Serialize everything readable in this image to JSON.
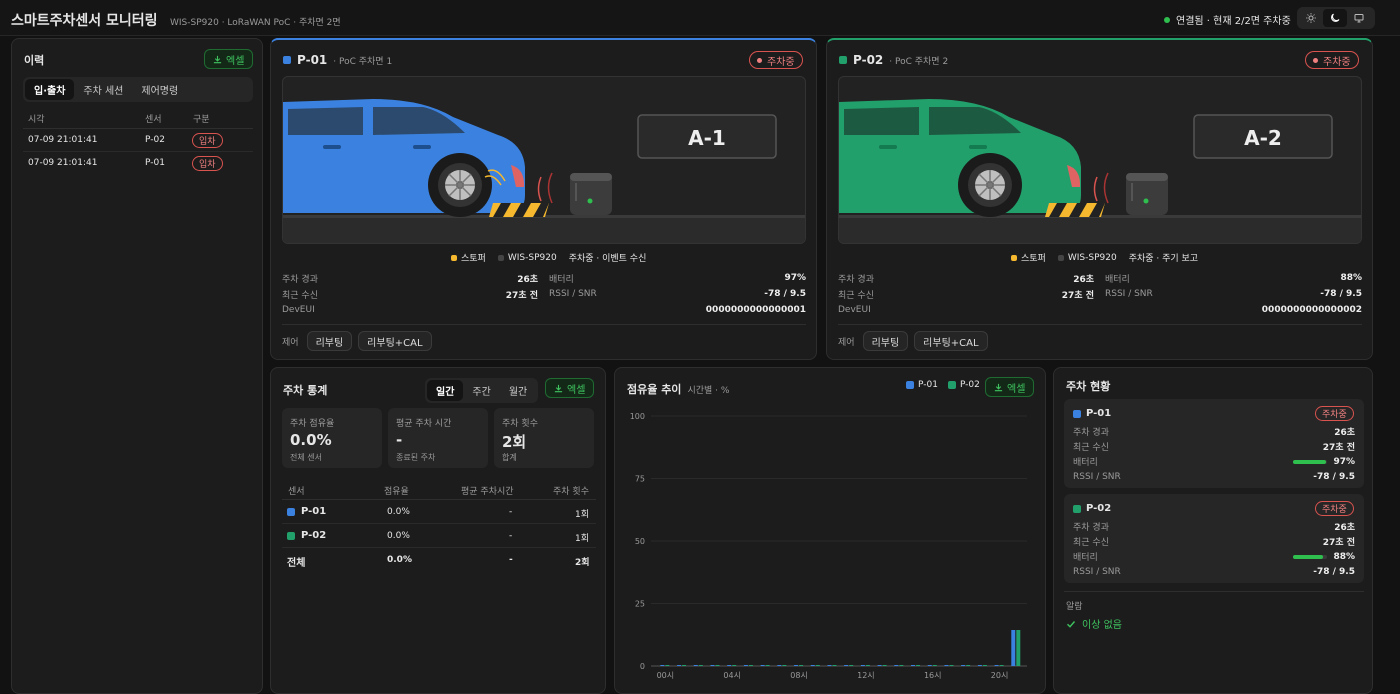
{
  "header": {
    "title": "스마트주차센서 모니터링",
    "subtitle": "WIS-SP920 · LoRaWAN PoC · 주차면 2면",
    "status": "연결됨 · 현재 2/2면 주차중",
    "theme_icons": [
      "sun-icon",
      "moon-icon",
      "monitor-icon"
    ],
    "status_color": "#2fbf4f"
  },
  "history": {
    "title": "이력",
    "export_label": "엑셀",
    "tabs": [
      "입·출차",
      "주차 세션",
      "제어명령"
    ],
    "columns": [
      "시각",
      "센서",
      "구분"
    ],
    "rows": [
      {
        "time": "07-09 21:01:41",
        "sensor": "P-02",
        "type": "입차"
      },
      {
        "time": "07-09 21:01:41",
        "sensor": "P-01",
        "type": "입차"
      }
    ]
  },
  "spots": [
    {
      "id": "P-01",
      "desc": "· PoC 주차면 1",
      "status": "주차중",
      "color": "#3b82e0",
      "sign": "A-1",
      "legend": [
        "스토퍼",
        "WIS-SP920",
        "주차중 · 이벤트 수신"
      ],
      "elapsed_label": "주차 경과",
      "elapsed": "26초",
      "battery_label": "배터리",
      "battery": "97%",
      "recv_label": "최근 수신",
      "recv": "27초 전",
      "rssi_label": "RSSI / SNR",
      "rssi": "-78 / 9.5",
      "deveui_label": "DevEUI",
      "deveui": "0000000000000001",
      "control_label": "제어",
      "btn_reboot": "리부팅",
      "btn_reboot_cal": "리부팅+CAL"
    },
    {
      "id": "P-02",
      "desc": "· PoC 주차면 2",
      "status": "주차중",
      "color": "#22a06b",
      "sign": "A-2",
      "legend": [
        "스토퍼",
        "WIS-SP920",
        "주차중 · 주기 보고"
      ],
      "elapsed_label": "주차 경과",
      "elapsed": "26초",
      "battery_label": "배터리",
      "battery": "88%",
      "recv_label": "최근 수신",
      "recv": "27초 전",
      "rssi_label": "RSSI / SNR",
      "rssi": "-78 / 9.5",
      "deveui_label": "DevEUI",
      "deveui": "0000000000000002",
      "control_label": "제어",
      "btn_reboot": "리부팅",
      "btn_reboot_cal": "리부팅+CAL"
    }
  ],
  "stats": {
    "title": "주차 통계",
    "periods": [
      "일간",
      "주간",
      "월간"
    ],
    "export_label": "엑셀",
    "boxes": [
      {
        "label": "주차 점유율",
        "value": "0.0%",
        "sub": "전체 센서"
      },
      {
        "label": "평균 주차 시간",
        "value": "-",
        "sub": "종료된 주차"
      },
      {
        "label": "주차 횟수",
        "value": "2회",
        "sub": "합계"
      }
    ],
    "columns": [
      "센서",
      "점유율",
      "평균 주차시간",
      "주차 횟수"
    ],
    "rows": [
      {
        "sensor": "P-01",
        "occ": "0.0%",
        "avg": "-",
        "count": "1회"
      },
      {
        "sensor": "P-02",
        "occ": "0.0%",
        "avg": "-",
        "count": "1회"
      }
    ],
    "total": {
      "sensor": "전체",
      "occ": "0.0%",
      "avg": "-",
      "count": "2회"
    }
  },
  "trend": {
    "title": "점유율 추이",
    "subtitle": "시간별 · %",
    "export_label": "엑셀"
  },
  "chart_data": {
    "type": "bar",
    "title": "점유율 추이",
    "subtitle": "시간별 · %",
    "ylim": [
      0,
      100
    ],
    "yticks": [
      "100",
      "75",
      "50",
      "25",
      "0"
    ],
    "xticks": [
      "00시",
      "04시",
      "08시",
      "12시",
      "16시",
      "20시"
    ],
    "grid": true,
    "legend": "top-right",
    "categories": [
      "0",
      "1",
      "2",
      "3",
      "4",
      "5",
      "6",
      "7",
      "8",
      "9",
      "10",
      "11",
      "12",
      "13",
      "14",
      "15",
      "16",
      "17",
      "18",
      "19",
      "20",
      "21"
    ],
    "series": [
      {
        "name": "P-01",
        "color": "#3b82e0",
        "values": [
          0,
          0,
          0,
          0,
          0,
          0,
          0,
          0,
          0,
          0,
          0,
          0,
          0,
          0,
          0,
          0,
          0,
          0,
          0,
          0,
          0,
          14
        ]
      },
      {
        "name": "P-02",
        "color": "#22a06b",
        "values": [
          0,
          0,
          0,
          0,
          0,
          0,
          0,
          0,
          0,
          0,
          0,
          0,
          0,
          0,
          0,
          0,
          0,
          0,
          0,
          0,
          0,
          14
        ]
      }
    ]
  },
  "status_panel": {
    "title": "주차 현황",
    "items": [
      {
        "id": "P-01",
        "status": "주차중",
        "elapsed_label": "주차 경과",
        "elapsed": "26초",
        "recv_label": "최근 수신",
        "recv": "27초 전",
        "battery_label": "배터리",
        "battery": "97%",
        "battery_level": 0.97,
        "rssi_label": "RSSI / SNR",
        "rssi": "-78 / 9.5"
      },
      {
        "id": "P-02",
        "status": "주차중",
        "elapsed_label": "주차 경과",
        "elapsed": "26초",
        "recv_label": "최근 수신",
        "recv": "27초 전",
        "battery_label": "배터리",
        "battery": "88%",
        "battery_level": 0.88,
        "rssi_label": "RSSI / SNR",
        "rssi": "-78 / 9.5"
      }
    ],
    "alarm_label": "알람",
    "alarm_value": "이상 없음"
  }
}
